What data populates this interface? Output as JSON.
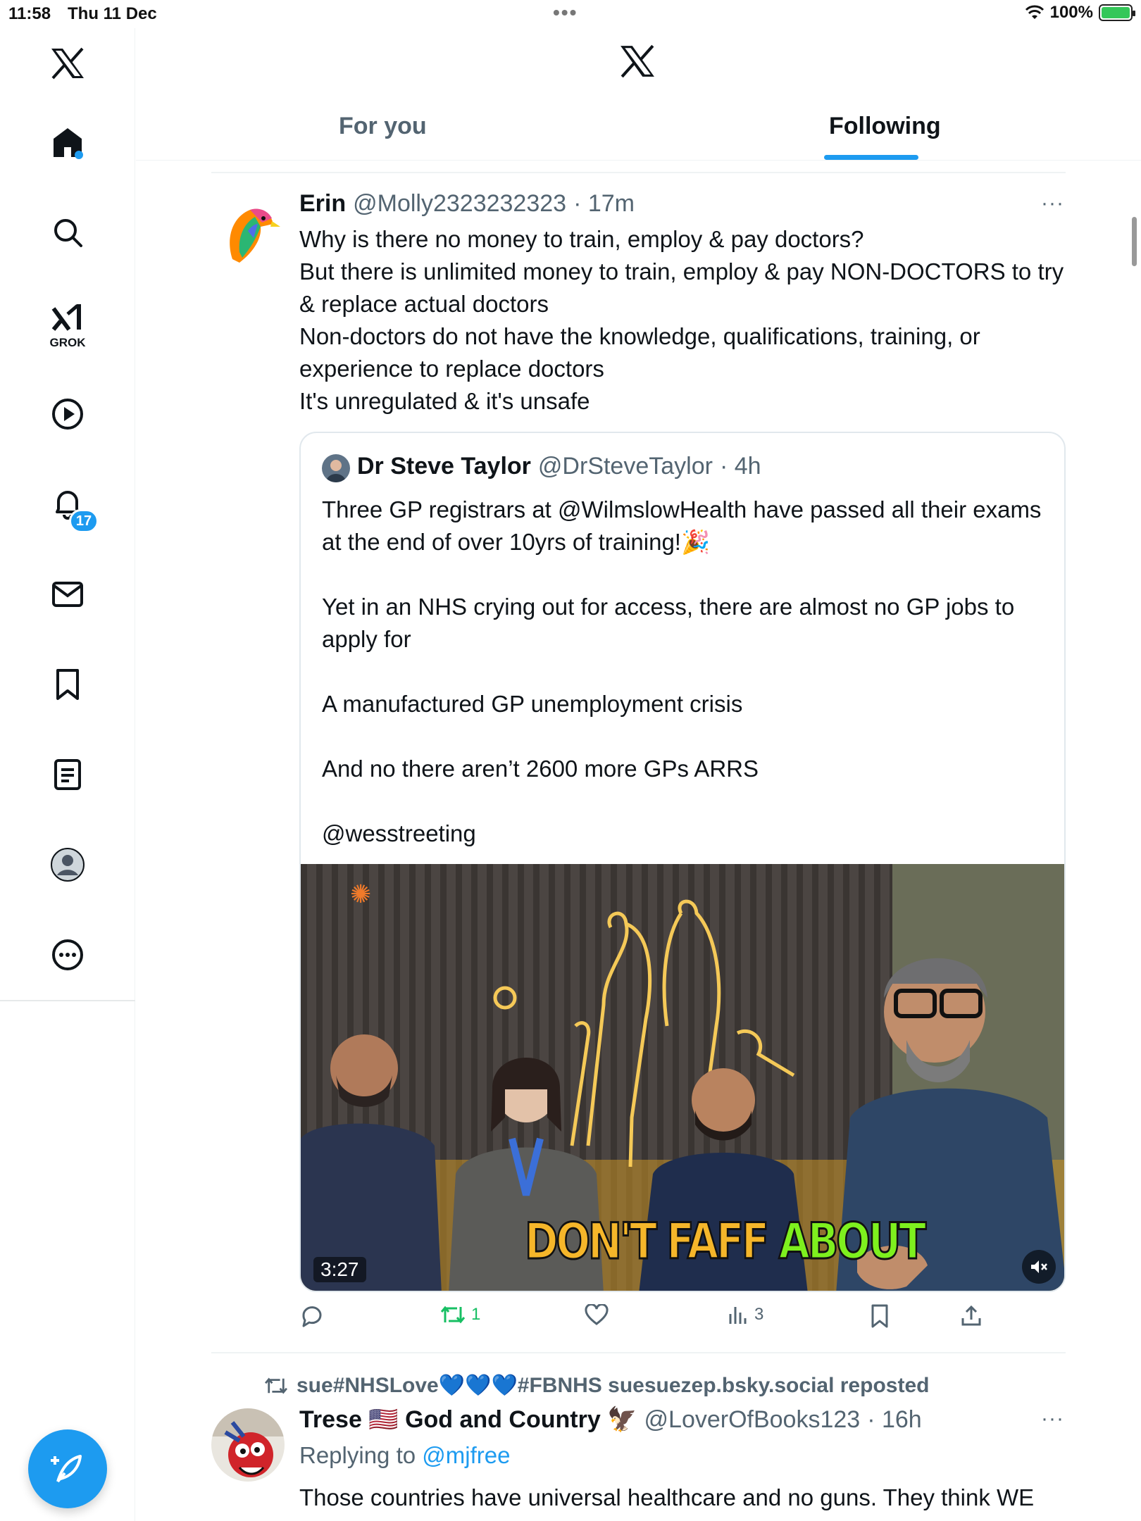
{
  "status_bar": {
    "time": "11:58",
    "date": "Thu 11 Dec",
    "battery": "100%"
  },
  "sidebar": {
    "grok_label": "GROK",
    "notifications_count": "17"
  },
  "header": {
    "tabs": [
      {
        "label": "For you"
      },
      {
        "label": "Following"
      }
    ],
    "active_tab": "Following"
  },
  "tweet1": {
    "name": "Erin",
    "handle": "@Molly2323232323",
    "time": "· 17m",
    "more": "···",
    "lines": [
      "Why is there no money to train, employ & pay doctors?",
      "But there is unlimited money to train, employ & pay NON-DOCTORS to try & replace actual doctors",
      "Non-doctors do not have the knowledge, qualifications, training, or experience to replace doctors",
      "It's unregulated & it's unsafe"
    ],
    "quote": {
      "name": "Dr Steve Taylor",
      "handle": "@DrSteveTaylor",
      "time": "· 4h",
      "paragraphs": [
        "Three GP registrars at @WilmslowHealth have passed all their exams at the end of over 10yrs of training!🎉",
        "Yet in an NHS crying out for access, there are almost no GP jobs to apply for",
        "A manufactured GP unemployment crisis",
        "And no there aren’t 2600 more GPs ARRS",
        "@wesstreeting"
      ],
      "video": {
        "duration": "3:27",
        "caption_part1": "DON'T FAFF",
        "caption_part2": "ABOUT"
      }
    },
    "actions": {
      "reply": "",
      "repost": "1",
      "like": "",
      "views": "3",
      "bookmark": "",
      "share": ""
    },
    "colors": {
      "repost_active": "#17bf63"
    }
  },
  "tweet2": {
    "repost_by": "sue#NHSLove💙💙💙#FBNHS suesuezep.bsky.social reposted",
    "name": "Trese 🇺🇸 God and Country 🦅",
    "handle": "@LoverOfBooks123",
    "time": "· 16h",
    "more": "···",
    "replying_prefix": "Replying to",
    "replying_to": "@mjfree",
    "text": "Those countries have universal healthcare and no guns. They think WE"
  },
  "colors": {
    "accent": "#1d9bf0",
    "text": "#0f1419",
    "muted": "#536471"
  }
}
